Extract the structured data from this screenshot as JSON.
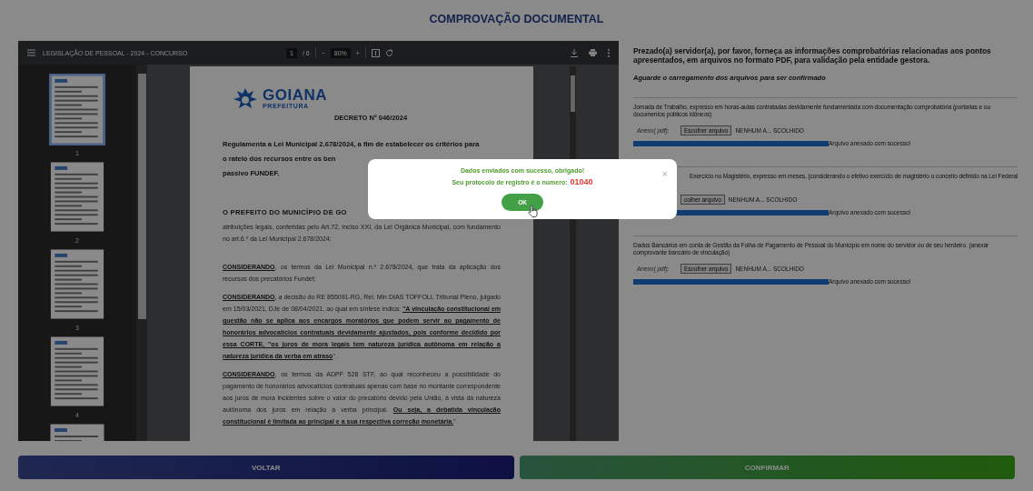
{
  "header": {
    "title": "COMPROVAÇÃO DOCUMENTAL"
  },
  "viewer": {
    "title": "LEGISLAÇÃO DE PESSOAL - 2024 - CONCURSO",
    "page": "1",
    "page_count": "/ 6",
    "zoom_out": "−",
    "zoom": "80%",
    "zoom_in": "+",
    "thumbnails": [
      {
        "label": "1",
        "selected": true
      },
      {
        "label": "2",
        "selected": false
      },
      {
        "label": "3",
        "selected": false
      },
      {
        "label": "4",
        "selected": false
      },
      {
        "selected": false
      }
    ],
    "document": {
      "logo": "GOIANA",
      "logo_sub": "PREFEITURA",
      "heading": "DECRETO Nº 046/2024",
      "summary_lines": [
        "Regulamenta a Lei Municipal 2.678/2024, a fim de estabelecer os critérios para",
        "o rateio dos recursos entre os ben",
        "passivo FUNDEF."
      ],
      "preamble_head": "O PREFEITO DO MUNICÍPIO DE GO",
      "preamble": "atribuições legais, conferidas pelo Art.72, Inciso XXI, da Lei Orgânica Municipal, com fundamento no art.6.º da Lei Municipal 2.678/2024:",
      "paragraphs": [
        "**CONSIDERANDO**, os termos da Lei Municipal n.º 2.678/2024, que trata da aplicação dos recursos dos precatórios Fundef;",
        "**CONSIDERANDO**, a decisão do RE 855091-RG, Rel. Min DIAS TOFFOLI, Tribunal Pleno, julgado em 15/03/2021, DJe de 08/04/2021, ao qual em síntese indica: **\"A vinculação constitucional em questão não se aplica aos encargos moratórios que podem servir ao pagamento de honorários advocatícios contratuais devidamente ajustados, pois conforme decidido por essa CORTE, \"os juros de mora legais tem natureza jurídica autônoma em relação a natureza jurídica da verba em atraso**\".",
        "**CONSIDERANDO**, os termos da ADPF 528 STF, ao qual reconheceu a possibilidade do pagamento de honorários advocatícios contratuais apenas com base no montante correspondente aos juros de mora incidentes sobre o valor do precatório devido pela União, à vista da natureza autônoma dos juros em relação à verba principal. **Ou seja, a debatida vinculação constitucional é limitada ao principal e a sua respectiva correção monetária.**\""
      ]
    }
  },
  "form": {
    "intro": "Prezado(a) servidor(a), por favor, forneça as informações comprobatórias relacionadas aos pontos apresentados, em arquivos no formato PDF, para validação pela entidade gestora.",
    "notice": "Aguarde o carregamento dos arquivos para ser confirmado",
    "sections": [
      {
        "description": "Jornada de Trabalho, expresso em horas-aulas contratadas devidamente fundamentada com documentação comprobatória (portarias e ou documentos públicos idôneos)",
        "partly_covered": false,
        "attach_label": "Anexo( pdf):",
        "file_button": "Escolher arquivo",
        "file_name": "NENHUM A... SCOLHIDO",
        "level": 1,
        "status": "Arquivo anexado com sucesso!"
      },
      {
        "description": "Exercício no Magistério, expresso em meses, (considerando o efetivo exercício de magistério o conceito definido na Lei Federal",
        "partly_covered": true,
        "file_button": "colher arquivo",
        "file_name": "NENHUM A... SCOLHIDO",
        "level": 1,
        "status": "Arquivo anexado com sucesso!"
      },
      {
        "description": "Dados Bancários em conta de Gestão da Folha de Pagamento de Pessoal do Município em nome do servidor ou de seu herdeiro. (anexar comprovante bancário de vinculação)",
        "partly_covered": false,
        "attach_label": "Anexo( pdf):",
        "file_button": "Escolher arquivo",
        "file_name": "NENHUM A... SCOLHIDO",
        "level": 1,
        "status": "Arquivo anexado com sucesso!"
      }
    ]
  },
  "actions": [
    {
      "label": "VOLTAR",
      "kind": "back"
    },
    {
      "label": "CONFIRMAR",
      "kind": "confirm"
    }
  ],
  "modal": {
    "message": "Dados enviados com sucesso, obrigado!",
    "protocol_label": "Seu protocolo de registro é o número:",
    "protocol": "01040",
    "close": "×",
    "button": "OK"
  }
}
